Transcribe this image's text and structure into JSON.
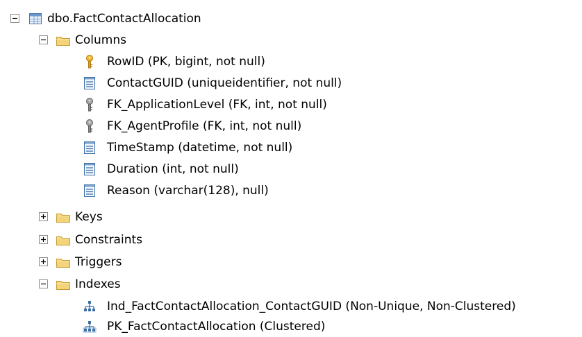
{
  "tree": {
    "root": {
      "label": "dbo.FactContactAllocation",
      "expanded": true,
      "icon": "table-icon"
    },
    "columns": {
      "label": "Columns",
      "expanded": true,
      "icon": "folder-icon",
      "items": [
        {
          "label": "RowID (PK, bigint, not null)",
          "icon": "primary-key-icon"
        },
        {
          "label": "ContactGUID (uniqueidentifier, not null)",
          "icon": "column-icon"
        },
        {
          "label": "FK_ApplicationLevel (FK, int, not null)",
          "icon": "foreign-key-icon"
        },
        {
          "label": "FK_AgentProfile (FK, int, not null)",
          "icon": "foreign-key-icon"
        },
        {
          "label": "TimeStamp (datetime, not null)",
          "icon": "column-icon"
        },
        {
          "label": "Duration (int, not null)",
          "icon": "column-icon"
        },
        {
          "label": "Reason (varchar(128), null)",
          "icon": "column-icon"
        }
      ]
    },
    "keys": {
      "label": "Keys",
      "expanded": false,
      "icon": "folder-icon"
    },
    "constraints": {
      "label": "Constraints",
      "expanded": false,
      "icon": "folder-icon"
    },
    "triggers": {
      "label": "Triggers",
      "expanded": false,
      "icon": "folder-icon"
    },
    "indexes": {
      "label": "Indexes",
      "expanded": true,
      "icon": "folder-icon",
      "items": [
        {
          "label": "Ind_FactContactAllocation_ContactGUID (Non-Unique, Non-Clustered)",
          "icon": "nonclustered-index-icon"
        },
        {
          "label": "PK_FactContactAllocation (Clustered)",
          "icon": "clustered-index-icon"
        }
      ]
    }
  },
  "colors": {
    "folder": "#f3d47a",
    "folder_dark": "#d9a93b",
    "key_gold": "#e0a21b",
    "key_gray": "#8a8a8a",
    "column_blue": "#3a6ea5",
    "index_blue": "#3a6ea5"
  }
}
